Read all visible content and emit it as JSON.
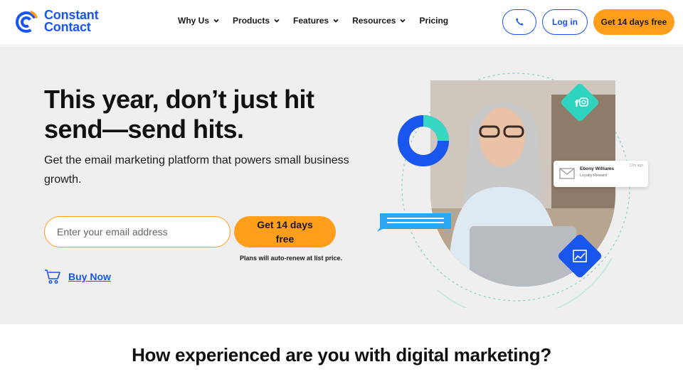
{
  "brand": {
    "name_line1": "Constant",
    "name_line2": "Contact",
    "primary_color": "#1856ed",
    "accent_color": "#ff9e1b"
  },
  "nav": {
    "items": [
      {
        "label": "Why Us",
        "has_dropdown": true
      },
      {
        "label": "Products",
        "has_dropdown": true
      },
      {
        "label": "Features",
        "has_dropdown": true
      },
      {
        "label": "Resources",
        "has_dropdown": true
      },
      {
        "label": "Pricing",
        "has_dropdown": false
      }
    ]
  },
  "header_actions": {
    "phone_icon": "phone-icon",
    "login_label": "Log in",
    "trial_label": "Get 14 days free"
  },
  "hero": {
    "headline": "This year, don’t just hit send—send hits.",
    "subhead": "Get the email marketing platform that powers small business growth.",
    "email_placeholder": "Enter your email address",
    "cta_label": "Get 14 days free",
    "renew_note": "Plans will auto-renew at list price.",
    "buy_now_label": "Buy Now",
    "cart_icon": "cart-icon"
  },
  "art": {
    "notification": {
      "name": "Ebony Williams",
      "subtitle": "Loyalty Reward",
      "time": "12m ago"
    }
  },
  "section": {
    "title": "How experienced are you with digital marketing?"
  }
}
